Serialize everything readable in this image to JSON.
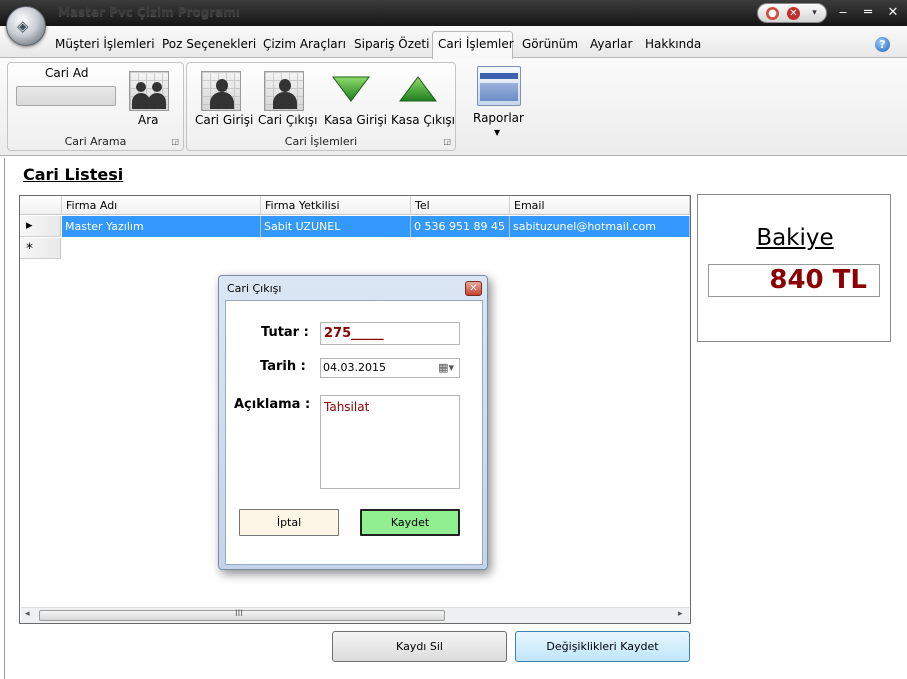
{
  "app": {
    "title": "Master Pvc Çizim Programı"
  },
  "menu": {
    "tabs": [
      "Müşteri İşlemleri",
      "Poz Seçenekleri",
      "Çizim Araçları",
      "Sipariş Özeti",
      "Cari İşlemler",
      "Görünüm",
      "Ayarlar",
      "Hakkında"
    ],
    "active": "Cari İşlemler"
  },
  "ribbon": {
    "cari_arama": {
      "label": "Cari Arama",
      "field_label": "Cari Ad",
      "search_button": "Ara"
    },
    "cari_islemleri": {
      "label": "Cari İşlemleri",
      "buttons": [
        "Cari Girişi",
        "Cari Çıkışı",
        "Kasa Girişi",
        "Kasa Çıkışı"
      ]
    },
    "raporlar": {
      "label": "Raporlar"
    }
  },
  "main": {
    "title": "Cari Listesi",
    "table": {
      "columns": [
        "Firma Adı",
        "Firma Yetkilisi",
        "Tel",
        "Email"
      ],
      "rows": [
        [
          "Master Yazılım",
          "Sabit UZUNEL",
          "0 536 951 89 45",
          "sabituzunel@hotmail.com"
        ]
      ],
      "selected_marker": "▸",
      "new_row_marker": "*",
      "scroll_grip": "III"
    },
    "buttons": {
      "delete": "Kaydı Sil",
      "save_changes": "Değişiklikleri Kaydet"
    }
  },
  "bakiye": {
    "title": "Bakiye",
    "value": "840 TL"
  },
  "dialog": {
    "title": "Cari Çıkışı",
    "tutar_label": "Tutar :",
    "tutar_value": "275_____",
    "tarih_label": "Tarih :",
    "tarih_value": "04.03.2015",
    "aciklama_label": "Açıklama :",
    "aciklama_value": "Tahsilat",
    "cancel": "İptal",
    "save": "Kaydet"
  },
  "colors": {
    "selection": "#3399ff",
    "amount": "#8b0000",
    "save_button": "#90ee90",
    "cancel_button": "#fdf5e6",
    "triangle": "#2e9e2e"
  },
  "icons": [
    "office-orb-icon",
    "close-icon",
    "minimize-icon",
    "maximize-icon",
    "help-icon",
    "people-icon",
    "person-icon",
    "arrow-down-icon",
    "arrow-up-icon",
    "report-icon",
    "calendar-icon"
  ]
}
